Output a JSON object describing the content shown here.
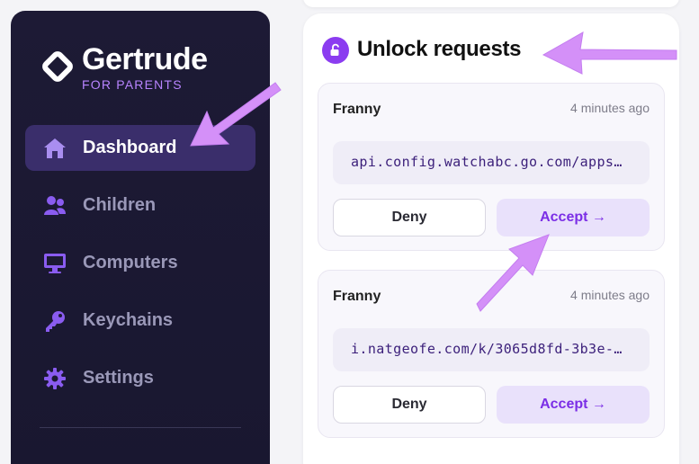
{
  "sidebar": {
    "brand": {
      "title": "Gertrude",
      "subtitle": "FOR PARENTS"
    },
    "items": [
      {
        "label": "Dashboard",
        "icon": "home-icon",
        "active": true
      },
      {
        "label": "Children",
        "icon": "users-icon",
        "active": false
      },
      {
        "label": "Computers",
        "icon": "monitor-icon",
        "active": false
      },
      {
        "label": "Keychains",
        "icon": "key-icon",
        "active": false
      },
      {
        "label": "Settings",
        "icon": "gear-icon",
        "active": false
      }
    ]
  },
  "main": {
    "title": "Unlock requests",
    "title_icon": "unlock-icon",
    "requests": [
      {
        "name": "Franny",
        "time": "4 minutes ago",
        "url": "api.config.watchabc.go.com/apps…",
        "deny_label": "Deny",
        "accept_label": "Accept →"
      },
      {
        "name": "Franny",
        "time": "4 minutes ago",
        "url": "i.natgeofe.com/k/3065d8fd-3b3e-…",
        "deny_label": "Deny",
        "accept_label": "Accept →"
      }
    ]
  },
  "colors": {
    "sidebar_bg": "#1c1a33",
    "active_item_bg": "#3a2e6b",
    "accent": "#8b3cf0",
    "brand_subtitle": "#b884ff",
    "annotation_arrow": "#d08cf7"
  }
}
